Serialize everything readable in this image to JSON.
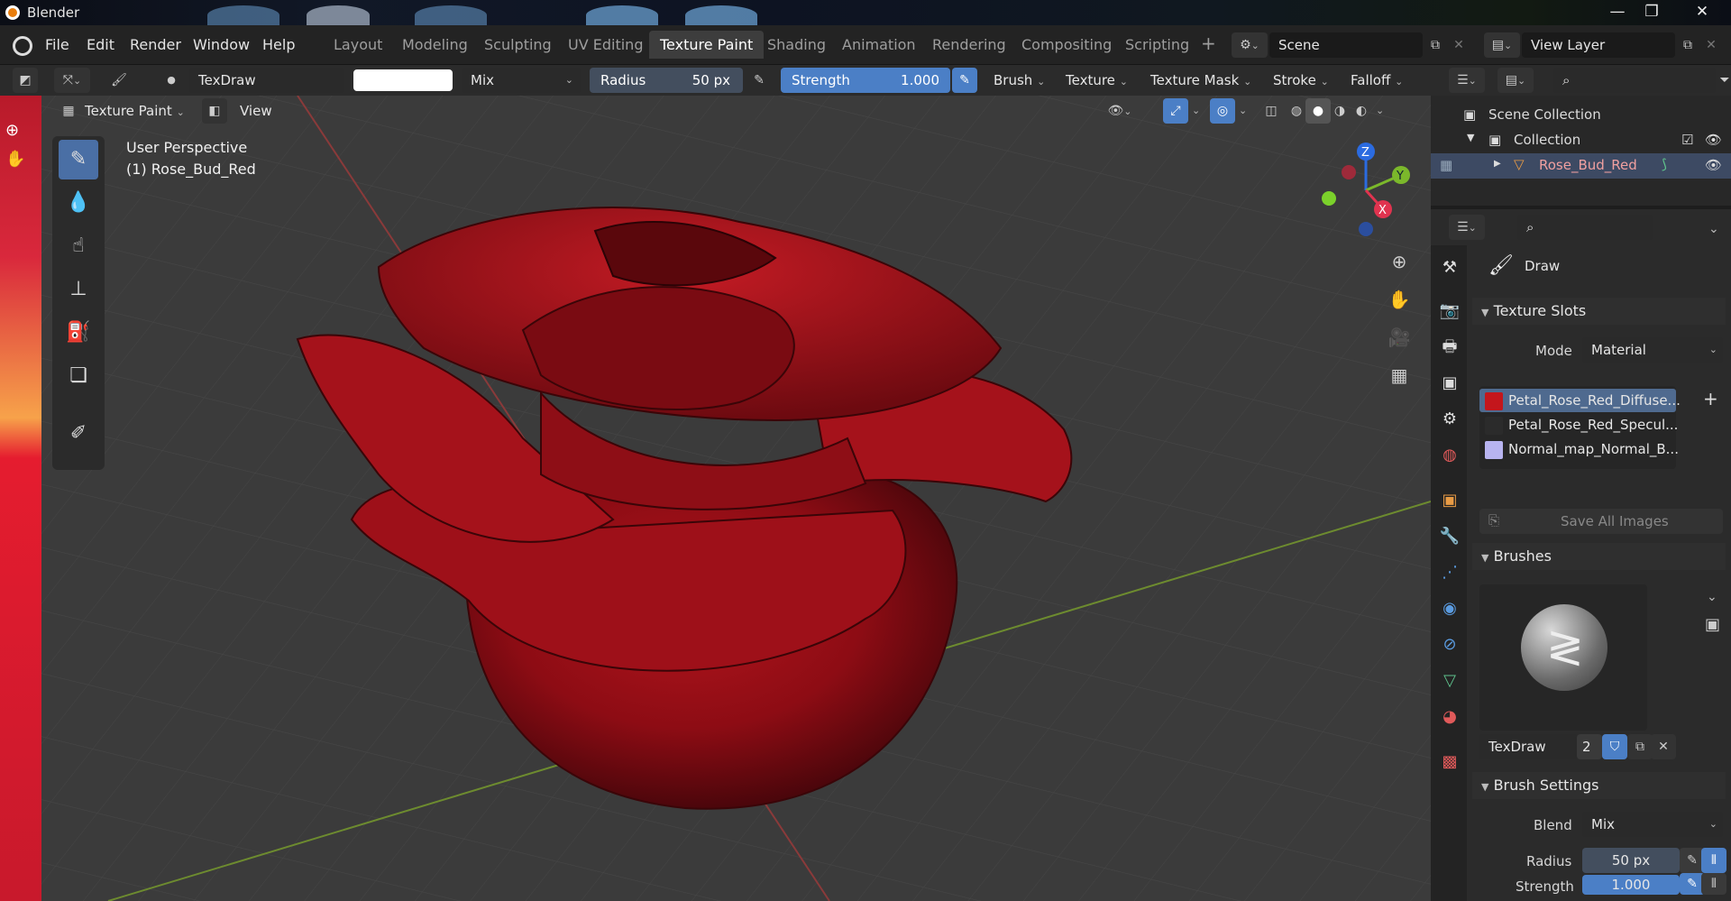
{
  "window": {
    "title": "Blender",
    "controls": [
      "—",
      "❐",
      "✕"
    ]
  },
  "menu": [
    "File",
    "Edit",
    "Render",
    "Window",
    "Help"
  ],
  "workspaces": [
    {
      "label": "Layout"
    },
    {
      "label": "Modeling"
    },
    {
      "label": "Sculpting"
    },
    {
      "label": "UV Editing"
    },
    {
      "label": "Texture Paint",
      "active": true
    },
    {
      "label": "Shading"
    },
    {
      "label": "Animation"
    },
    {
      "label": "Rendering"
    },
    {
      "label": "Compositing"
    },
    {
      "label": "Scripting"
    }
  ],
  "scene": "Scene",
  "view_layer": "View Layer",
  "toolheader": {
    "brush_name": "TexDraw",
    "blend": "Mix",
    "radius_label": "Radius",
    "radius_value": "50 px",
    "strength_label": "Strength",
    "strength_value": "1.000",
    "menus": [
      "Brush",
      "Texture",
      "Texture Mask",
      "Stroke",
      "Falloff"
    ]
  },
  "viewheader": {
    "mode": "Texture Paint",
    "view": "View"
  },
  "viewport": {
    "perspective": "User Perspective",
    "object": "(1) Rose_Bud_Red",
    "axes": [
      "Z",
      "Y",
      "X"
    ]
  },
  "outliner": {
    "scene_collection": "Scene Collection",
    "collection": "Collection",
    "object": "Rose_Bud_Red"
  },
  "properties": {
    "tool_name": "Draw",
    "texture_slots": {
      "title": "Texture Slots",
      "mode_label": "Mode",
      "mode_value": "Material",
      "slots": [
        {
          "name": "Petal_Rose_Red_Diffuse...",
          "color": "#c4161c"
        },
        {
          "name": "Petal_Rose_Red_Specul...",
          "color": "#2b2b2b"
        },
        {
          "name": "Normal_map_Normal_B...",
          "color": "#b8b4f0"
        }
      ],
      "save_label": "Save All Images"
    },
    "brushes": {
      "title": "Brushes",
      "brush_name": "TexDraw",
      "users": "2"
    },
    "brush_settings": {
      "title": "Brush Settings",
      "blend_label": "Blend",
      "blend_value": "Mix",
      "radius_label": "Radius",
      "radius_value": "50 px",
      "strength_label": "Strength",
      "strength_value": "1.000"
    }
  }
}
